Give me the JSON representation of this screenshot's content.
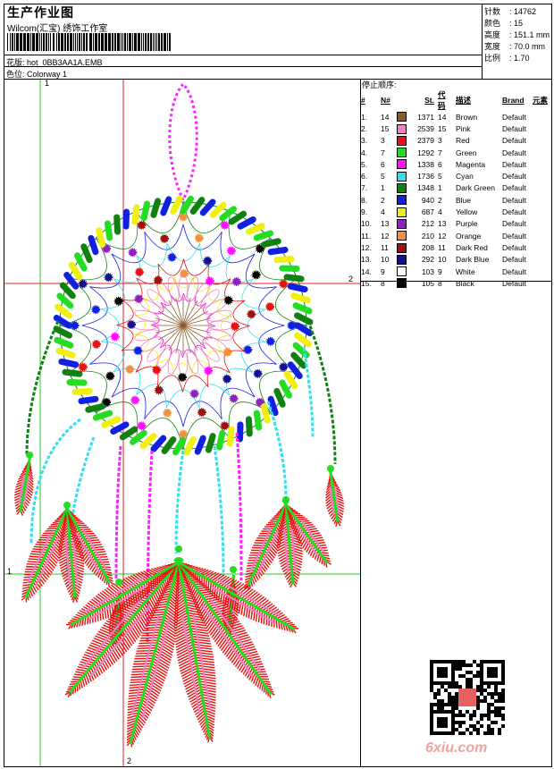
{
  "header": {
    "title": "生产作业图",
    "company": "Wilcom(汇宝) 绣饰工作室",
    "design_label": "花版: hot_0BB3AA1A.EMB",
    "colorway_label": "色位:  Colorway 1"
  },
  "stats": [
    {
      "k": "针数",
      "v": "14762"
    },
    {
      "k": "颜色",
      "v": "15"
    },
    {
      "k": "高度",
      "v": "151.1 mm"
    },
    {
      "k": "宽度",
      "v": "70.0 mm"
    },
    {
      "k": "比例",
      "v": "1.70"
    }
  ],
  "stop_sequence": {
    "label": "停止顺序:",
    "headers": {
      "idx": "#",
      "n": "N#",
      "st": "St.",
      "code": "代码",
      "desc": "描述",
      "brand": "Brand",
      "element": "元素"
    },
    "rows": [
      {
        "idx": "1.",
        "n": "14",
        "color": "#8b5a2b",
        "st": "1371",
        "code": "14",
        "desc": "Brown",
        "brand": "Default"
      },
      {
        "idx": "2.",
        "n": "15",
        "color": "#f080c0",
        "st": "2539",
        "code": "15",
        "desc": "Pink",
        "brand": "Default"
      },
      {
        "idx": "3.",
        "n": "3",
        "color": "#e81010",
        "st": "2379",
        "code": "3",
        "desc": "Red",
        "brand": "Default"
      },
      {
        "idx": "4.",
        "n": "7",
        "color": "#22dd22",
        "st": "1292",
        "code": "7",
        "desc": "Green",
        "brand": "Default"
      },
      {
        "idx": "5.",
        "n": "6",
        "color": "#ff10ff",
        "st": "1338",
        "code": "6",
        "desc": "Magenta",
        "brand": "Default"
      },
      {
        "idx": "6.",
        "n": "5",
        "color": "#30e0f0",
        "st": "1736",
        "code": "5",
        "desc": "Cyan",
        "brand": "Default"
      },
      {
        "idx": "7.",
        "n": "1",
        "color": "#108010",
        "st": "1348",
        "code": "1",
        "desc": "Dark Green",
        "brand": "Default"
      },
      {
        "idx": "8.",
        "n": "2",
        "color": "#1020e0",
        "st": "940",
        "code": "2",
        "desc": "Blue",
        "brand": "Default"
      },
      {
        "idx": "9.",
        "n": "4",
        "color": "#f0f010",
        "st": "687",
        "code": "4",
        "desc": "Yellow",
        "brand": "Default"
      },
      {
        "idx": "10.",
        "n": "13",
        "color": "#9020c0",
        "st": "212",
        "code": "13",
        "desc": "Purple",
        "brand": "Default"
      },
      {
        "idx": "11.",
        "n": "12",
        "color": "#f09040",
        "st": "210",
        "code": "12",
        "desc": "Orange",
        "brand": "Default"
      },
      {
        "idx": "12.",
        "n": "11",
        "color": "#a01010",
        "st": "208",
        "code": "11",
        "desc": "Dark Red",
        "brand": "Default"
      },
      {
        "idx": "13.",
        "n": "10",
        "color": "#101090",
        "st": "292",
        "code": "10",
        "desc": "Dark Blue",
        "brand": "Default"
      },
      {
        "idx": "14.",
        "n": "9",
        "color": "#ffffff",
        "st": "103",
        "code": "9",
        "desc": "White",
        "brand": "Default"
      },
      {
        "idx": "15.",
        "n": "8",
        "color": "#000000",
        "st": "105",
        "code": "8",
        "desc": "Black",
        "brand": "Default"
      }
    ]
  },
  "axes": {
    "top_1": "1",
    "right_2": "2",
    "left_1": "1",
    "bottom_2": "2"
  },
  "watermark": "6xiu.com"
}
